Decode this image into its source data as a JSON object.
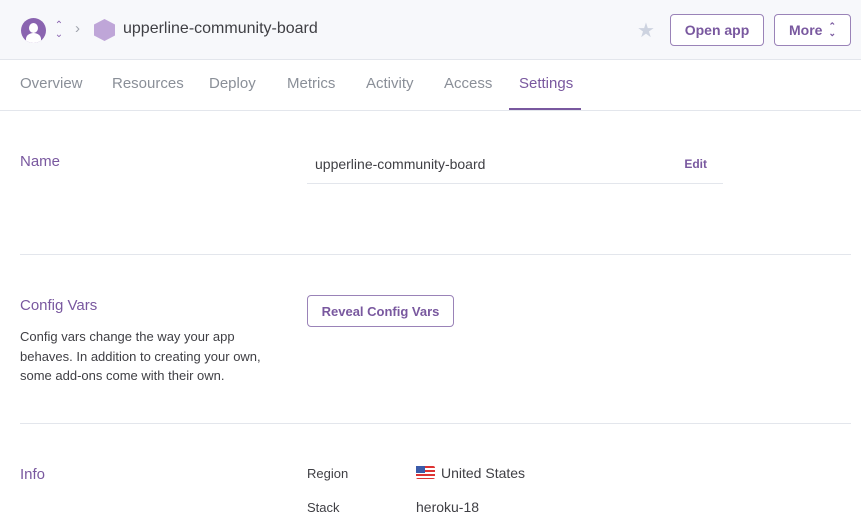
{
  "header": {
    "app_name": "upperline-community-board",
    "open_app": "Open app",
    "more": "More",
    "star_icon": "★",
    "chevron": "›",
    "updown": "⌃⌄"
  },
  "tabs": [
    {
      "label": "Overview"
    },
    {
      "label": "Resources"
    },
    {
      "label": "Deploy"
    },
    {
      "label": "Metrics"
    },
    {
      "label": "Activity"
    },
    {
      "label": "Access"
    },
    {
      "label": "Settings",
      "active": true
    }
  ],
  "name_section": {
    "title": "Name",
    "value": "upperline-community-board",
    "edit": "Edit"
  },
  "config_section": {
    "title": "Config Vars",
    "description": "Config vars change the way your app behaves. In addition to creating your own, some add-ons come with their own.",
    "button": "Reveal Config Vars"
  },
  "info_section": {
    "title": "Info",
    "rows": [
      {
        "label": "Region",
        "value": "United States"
      },
      {
        "label": "Stack",
        "value": "heroku-18"
      }
    ]
  }
}
